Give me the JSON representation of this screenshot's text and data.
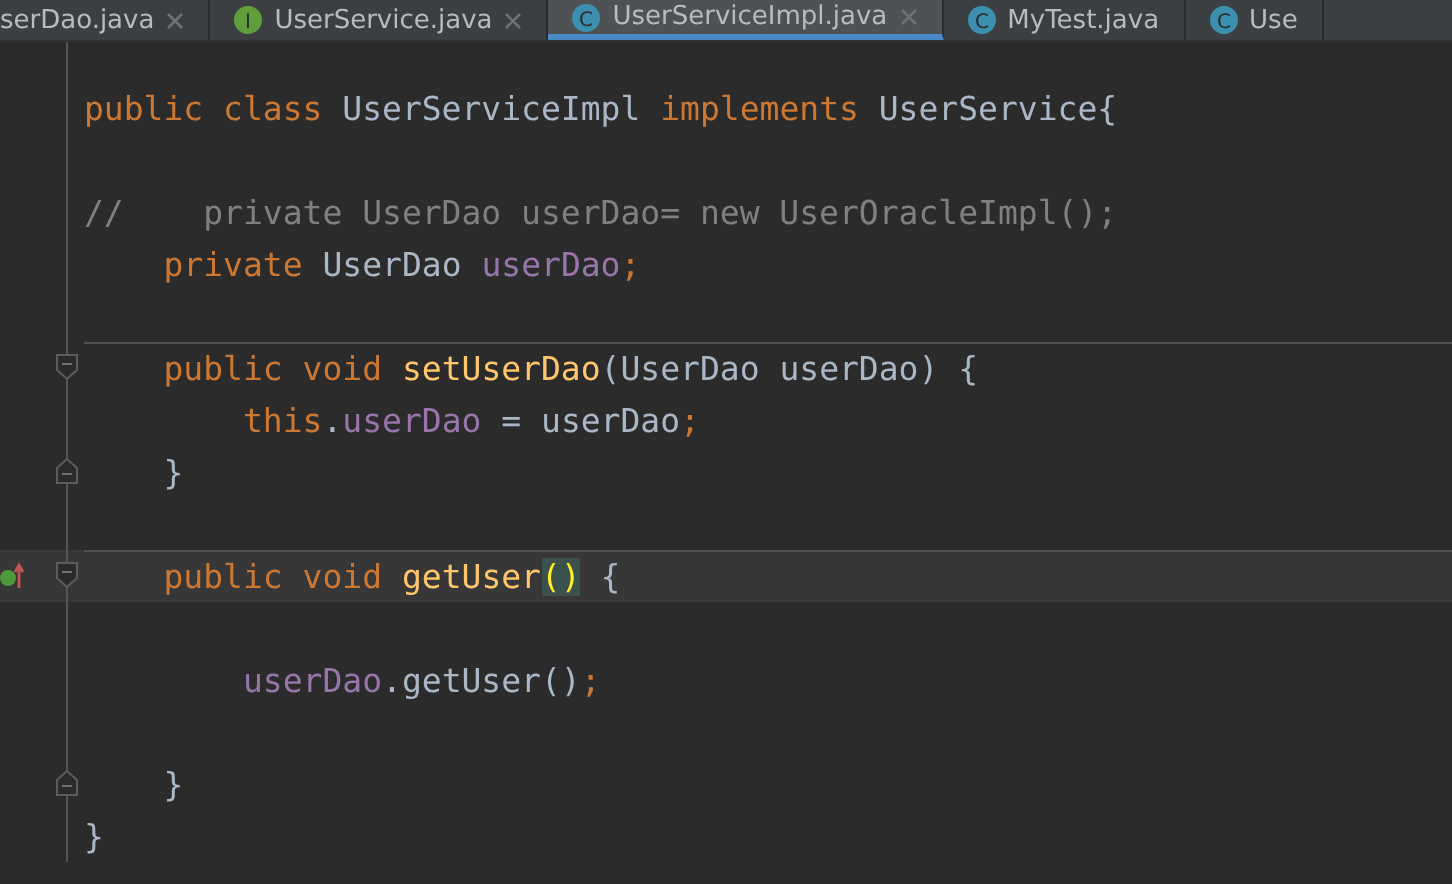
{
  "tabs": [
    {
      "label": "serDao.java",
      "selected": false,
      "closable": true
    },
    {
      "label": "UserService.java",
      "icon_letter": "I",
      "kind": "interface",
      "selected": false,
      "closable": true
    },
    {
      "label": "UserServiceImpl.java",
      "icon_letter": "C",
      "kind": "class",
      "selected": true,
      "closable": true
    },
    {
      "label": "MyTest.java",
      "icon_letter": "C",
      "kind": "class",
      "selected": false,
      "closable": false
    },
    {
      "label": "Use",
      "icon_letter": "C",
      "kind": "class",
      "selected": false,
      "closable": false
    }
  ],
  "lines": [
    {
      "fold_start": false,
      "fold_end": false,
      "current": false,
      "separator_above": false,
      "implements_marker": false,
      "tokens": [
        {
          "kind": "keyword",
          "text": "public class "
        },
        {
          "kind": "plain",
          "text": "UserServiceImpl "
        },
        {
          "kind": "keyword",
          "text": "implements "
        },
        {
          "kind": "plain",
          "text": "UserService{"
        }
      ]
    },
    {
      "fold_start": false,
      "fold_end": false,
      "current": false,
      "separator_above": false,
      "implements_marker": false
    },
    {
      "fold_start": false,
      "fold_end": false,
      "current": false,
      "separator_above": false,
      "implements_marker": false,
      "tokens": [
        {
          "kind": "comment",
          "text": "//    private UserDao userDao= new UserOracleImpl();"
        }
      ]
    },
    {
      "fold_start": false,
      "fold_end": false,
      "current": false,
      "separator_above": false,
      "implements_marker": false,
      "tokens": [
        {
          "kind": "keyword",
          "text": "    private "
        },
        {
          "kind": "plain",
          "text": "UserDao "
        },
        {
          "kind": "field",
          "text": "userDao"
        },
        {
          "kind": "keyword",
          "text": ";"
        }
      ]
    },
    {
      "fold_start": false,
      "fold_end": false,
      "current": false,
      "separator_above": false,
      "implements_marker": false
    },
    {
      "fold_start": true,
      "fold_end": false,
      "current": false,
      "separator_above": true,
      "implements_marker": false,
      "tokens": [
        {
          "kind": "keyword",
          "text": "    public void "
        },
        {
          "kind": "method",
          "text": "setUserDao"
        },
        {
          "kind": "plain",
          "text": "(UserDao userDao) {"
        }
      ]
    },
    {
      "fold_start": false,
      "fold_end": false,
      "current": false,
      "separator_above": false,
      "implements_marker": false,
      "tokens": [
        {
          "kind": "keyword",
          "text": "        this"
        },
        {
          "kind": "plain",
          "text": "."
        },
        {
          "kind": "field",
          "text": "userDao"
        },
        {
          "kind": "plain",
          "text": " = userDao"
        },
        {
          "kind": "keyword",
          "text": ";"
        }
      ]
    },
    {
      "fold_start": false,
      "fold_end": true,
      "current": false,
      "separator_above": false,
      "implements_marker": false,
      "tokens": [
        {
          "kind": "plain",
          "text": "    }"
        }
      ]
    },
    {
      "fold_start": false,
      "fold_end": false,
      "current": false,
      "separator_above": false,
      "implements_marker": false
    },
    {
      "fold_start": true,
      "fold_end": false,
      "current": true,
      "separator_above": true,
      "implements_marker": true,
      "tokens": [
        {
          "kind": "keyword",
          "text": "    public void "
        },
        {
          "kind": "method",
          "text": "getUser"
        },
        {
          "kind": "brace-match",
          "text": "()"
        },
        {
          "kind": "plain",
          "text": " {"
        }
      ]
    },
    {
      "fold_start": false,
      "fold_end": false,
      "current": false,
      "separator_above": false,
      "implements_marker": false
    },
    {
      "fold_start": false,
      "fold_end": false,
      "current": false,
      "separator_above": false,
      "implements_marker": false,
      "tokens": [
        {
          "kind": "field",
          "text": "        userDao"
        },
        {
          "kind": "plain",
          "text": ".getUser()"
        },
        {
          "kind": "keyword",
          "text": ";"
        }
      ]
    },
    {
      "fold_start": false,
      "fold_end": false,
      "current": false,
      "separator_above": false,
      "implements_marker": false
    },
    {
      "fold_start": false,
      "fold_end": true,
      "current": false,
      "separator_above": false,
      "implements_marker": false,
      "tokens": [
        {
          "kind": "plain",
          "text": "    }"
        }
      ]
    },
    {
      "fold_start": false,
      "fold_end": false,
      "current": false,
      "separator_above": false,
      "implements_marker": false,
      "tokens": [
        {
          "kind": "plain",
          "text": "}"
        }
      ]
    }
  ]
}
